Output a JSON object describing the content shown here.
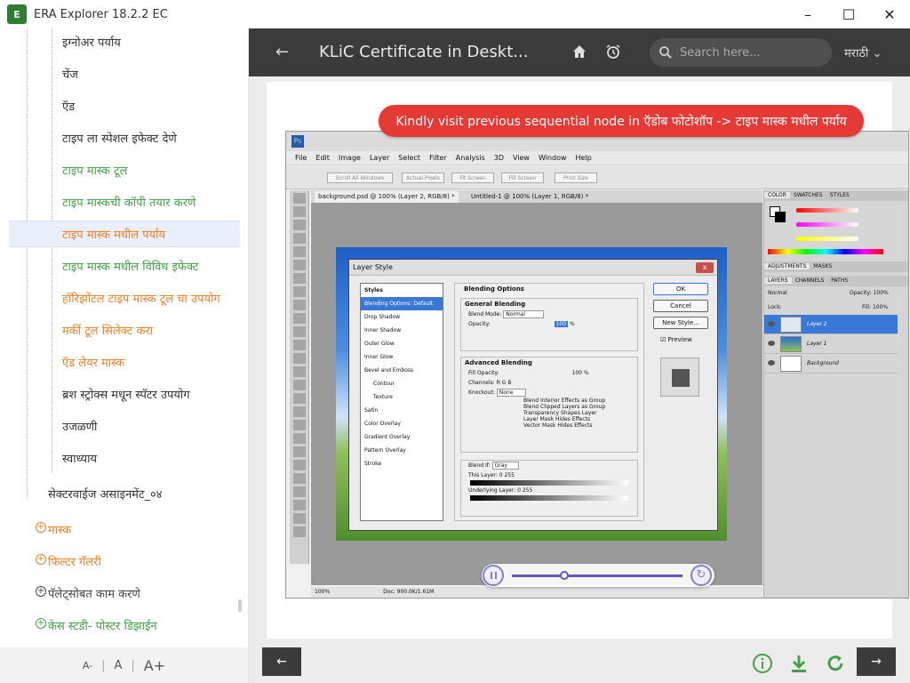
{
  "window": {
    "title": "ERA Explorer 18.2.2 EC",
    "icon_text": "E",
    "minimize": "–",
    "maximize": "☐",
    "close": "✕"
  },
  "sidebar": {
    "items": [
      {
        "label": "इग्नोअर पर्याय",
        "style": "dark"
      },
      {
        "label": "चेंज",
        "style": "dark"
      },
      {
        "label": "ऍड",
        "style": "dark"
      },
      {
        "label": "टाइप ला स्पेशल इफेक्ट देणे",
        "style": "dark"
      },
      {
        "label": "टाइप मास्क टूल",
        "style": "green"
      },
      {
        "label": "टाइप मास्कची कॉपी तयार करणे",
        "style": "green"
      },
      {
        "label": "टाइप मास्क मधील पर्याय",
        "style": "orange",
        "selected": true
      },
      {
        "label": "टाइप मास्क मधील विविध इफेक्ट",
        "style": "green"
      },
      {
        "label": "हॉरिझोंटल टाइप मास्क टूल चा उपयोग",
        "style": "orange"
      },
      {
        "label": "मर्की टूल सिलेक्ट करा",
        "style": "orange"
      },
      {
        "label": "ऍड लेयर मास्क",
        "style": "orange"
      },
      {
        "label": "ब्रश स्ट्रोक्स मधून स्पॅटर उपयोग",
        "style": "dark"
      },
      {
        "label": "उजळणी",
        "style": "dark"
      },
      {
        "label": "स्वाध्याय",
        "style": "dark"
      }
    ],
    "assignment": "सेक्टरवाईज असाइनमेंट_०४",
    "sections": [
      {
        "label": "मास्क",
        "style": "orange"
      },
      {
        "label": "फिल्टर गॅलरी",
        "style": "orange"
      },
      {
        "label": "पॅलेट्सोबत काम करणे",
        "style": "dark"
      },
      {
        "label": "केस स्टडी- पोस्टर डिझाईन",
        "style": "green"
      }
    ],
    "font_small": "A-",
    "font_normal": "A",
    "font_large": "A+"
  },
  "header": {
    "title": "KLiC Certificate in Deskt...",
    "search_placeholder": "Search here...",
    "language": "मराठी"
  },
  "banner": "Kindly visit previous sequential node in ऍडोब फोटोशॉप -> टाइप मास्क मधील पर्याय",
  "photoshop": {
    "logo": "Ps",
    "menu": [
      "File",
      "Edit",
      "Image",
      "Layer",
      "Select",
      "Filter",
      "Analysis",
      "3D",
      "View",
      "Window",
      "Help"
    ],
    "options": [
      "Scroll All Windows",
      "Actual Pixels",
      "Fit Screen",
      "Fill Screen",
      "Print Size"
    ],
    "tabs": [
      "background.psd @ 100% (Layer 2, RGB/8) *",
      "Untitled-1 @ 100% (Layer 1, RGB/8) *"
    ],
    "dialog_title": "Layer Style",
    "styles_header": "Styles",
    "styles": [
      "Blending Options: Default",
      "Drop Shadow",
      "Inner Shadow",
      "Outer Glow",
      "Inner Glow",
      "Bevel and Emboss",
      "Contour",
      "Texture",
      "Satin",
      "Color Overlay",
      "Gradient Overlay",
      "Pattern Overlay",
      "Stroke"
    ],
    "blending_title": "Blending Options",
    "general_blending": "General Blending",
    "blend_mode": "Blend Mode:",
    "blend_mode_value": "Normal",
    "opacity": "Opacity:",
    "opacity_value": "100",
    "advanced_blending": "Advanced Blending",
    "fill_opacity": "Fill Opacity:",
    "fill_opacity_value": "100",
    "channels": "Channels:  R   G   B",
    "knockout": "Knockout:",
    "knockout_value": "None",
    "adv_opts": [
      "Blend Interior Effects as Group",
      "Blend Clipped Layers as Group",
      "Transparency Shapes Layer",
      "Layer Mask Hides Effects",
      "Vector Mask Hides Effects"
    ],
    "blend_if": "Blend If:",
    "blend_if_value": "Gray",
    "this_layer": "This Layer:   0          255",
    "underlying_layer": "Underlying Layer:   0          255",
    "ok": "OK",
    "cancel": "Cancel",
    "new_style": "New Style...",
    "preview": "Preview",
    "color_tabs": [
      "COLOR",
      "SWATCHES",
      "STYLES"
    ],
    "adjust_tabs": [
      "ADJUSTMENTS",
      "MASKS"
    ],
    "layer_tabs": [
      "LAYERS",
      "CHANNELS",
      "PATHS"
    ],
    "layer_mode": "Normal",
    "layer_opacity": "Opacity: 100%",
    "lock": "Lock:",
    "fill": "Fill: 100%",
    "layers": [
      "Layer 2",
      "Layer 1",
      "Background"
    ],
    "zoom": "100%",
    "doc_info": "Doc: 900.0K/1.61M"
  },
  "colors": {
    "header_bg": "#3b3b3b",
    "banner": "#e53935",
    "green": "#43a047",
    "orange": "#ef7d22",
    "accent": "#2e7d32"
  }
}
